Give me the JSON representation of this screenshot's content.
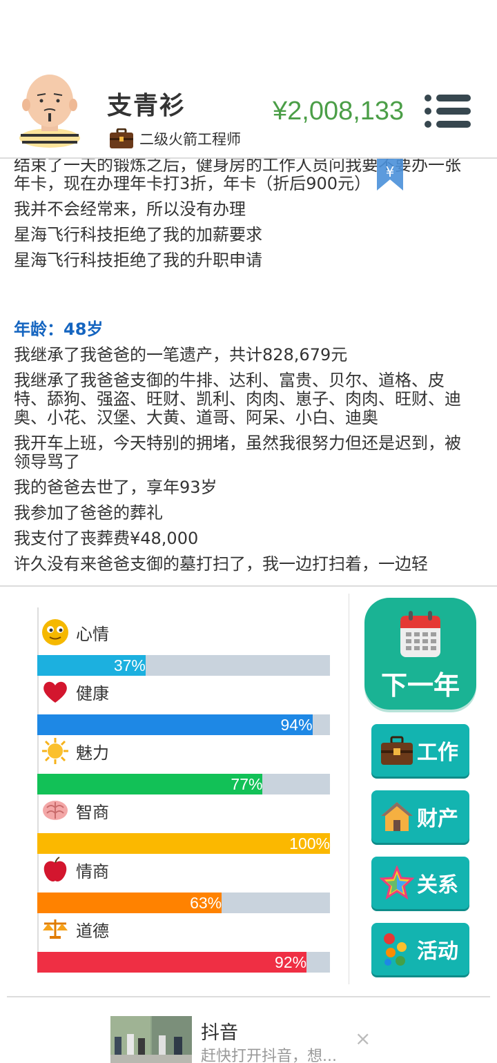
{
  "header": {
    "name": "支青衫",
    "job_title": "二级火箭工程师",
    "money": "¥2,008,133"
  },
  "log": {
    "lines": [
      "结束了一天的锻炼之后，健身房的工作人员问我要不要办一张年卡，现在办理年卡打3折，年卡（折后900元）",
      "我并不会经常来，所以没有办理",
      "星海飞行科技拒绝了我的加薪要求",
      "星海飞行科技拒绝了我的升职申请"
    ],
    "age_heading": "年龄：48岁",
    "lines2": [
      "我继承了我爸爸的一笔遗产，共计828,679元",
      "我继承了我爸爸支御的牛排、达利、富贵、贝尔、道格、皮特、舔狗、强盗、旺财、凯利、肉肉、崽子、肉肉、旺财、迪奥、小花、汉堡、大黄、道哥、阿呆、小白、迪奥",
      "我开车上班，今天特别的拥堵，虽然我很努力但还是迟到，被领导骂了",
      "我的爸爸去世了，享年93岁",
      "我参加了爸爸的葬礼",
      "我支付了丧葬费¥48,000",
      "许久没有来爸爸支御的墓打扫了，我一边打扫着，一边轻"
    ],
    "float_symbol": "¥"
  },
  "stats": [
    {
      "label": "心情",
      "percent": 37,
      "text": "37%",
      "color": "#1cb0df",
      "icon": "smiley-icon"
    },
    {
      "label": "健康",
      "percent": 94,
      "text": "94%",
      "color": "#1e88e5",
      "icon": "heart-icon"
    },
    {
      "label": "魅力",
      "percent": 77,
      "text": "77%",
      "color": "#12c157",
      "icon": "sun-icon"
    },
    {
      "label": "智商",
      "percent": 100,
      "text": "100%",
      "color": "#fbb800",
      "icon": "brain-icon"
    },
    {
      "label": "情商",
      "percent": 63,
      "text": "63%",
      "color": "#ff8200",
      "icon": "apple-icon"
    },
    {
      "label": "道德",
      "percent": 92,
      "text": "92%",
      "color": "#ef2f44",
      "icon": "scales-icon"
    }
  ],
  "actions": {
    "next_year": "下一年",
    "work": "工作",
    "property": "财产",
    "relations": "关系",
    "activities": "活动"
  },
  "ad": {
    "title": "抖音",
    "desc": "赶快打开抖音，想...",
    "close": "×"
  }
}
